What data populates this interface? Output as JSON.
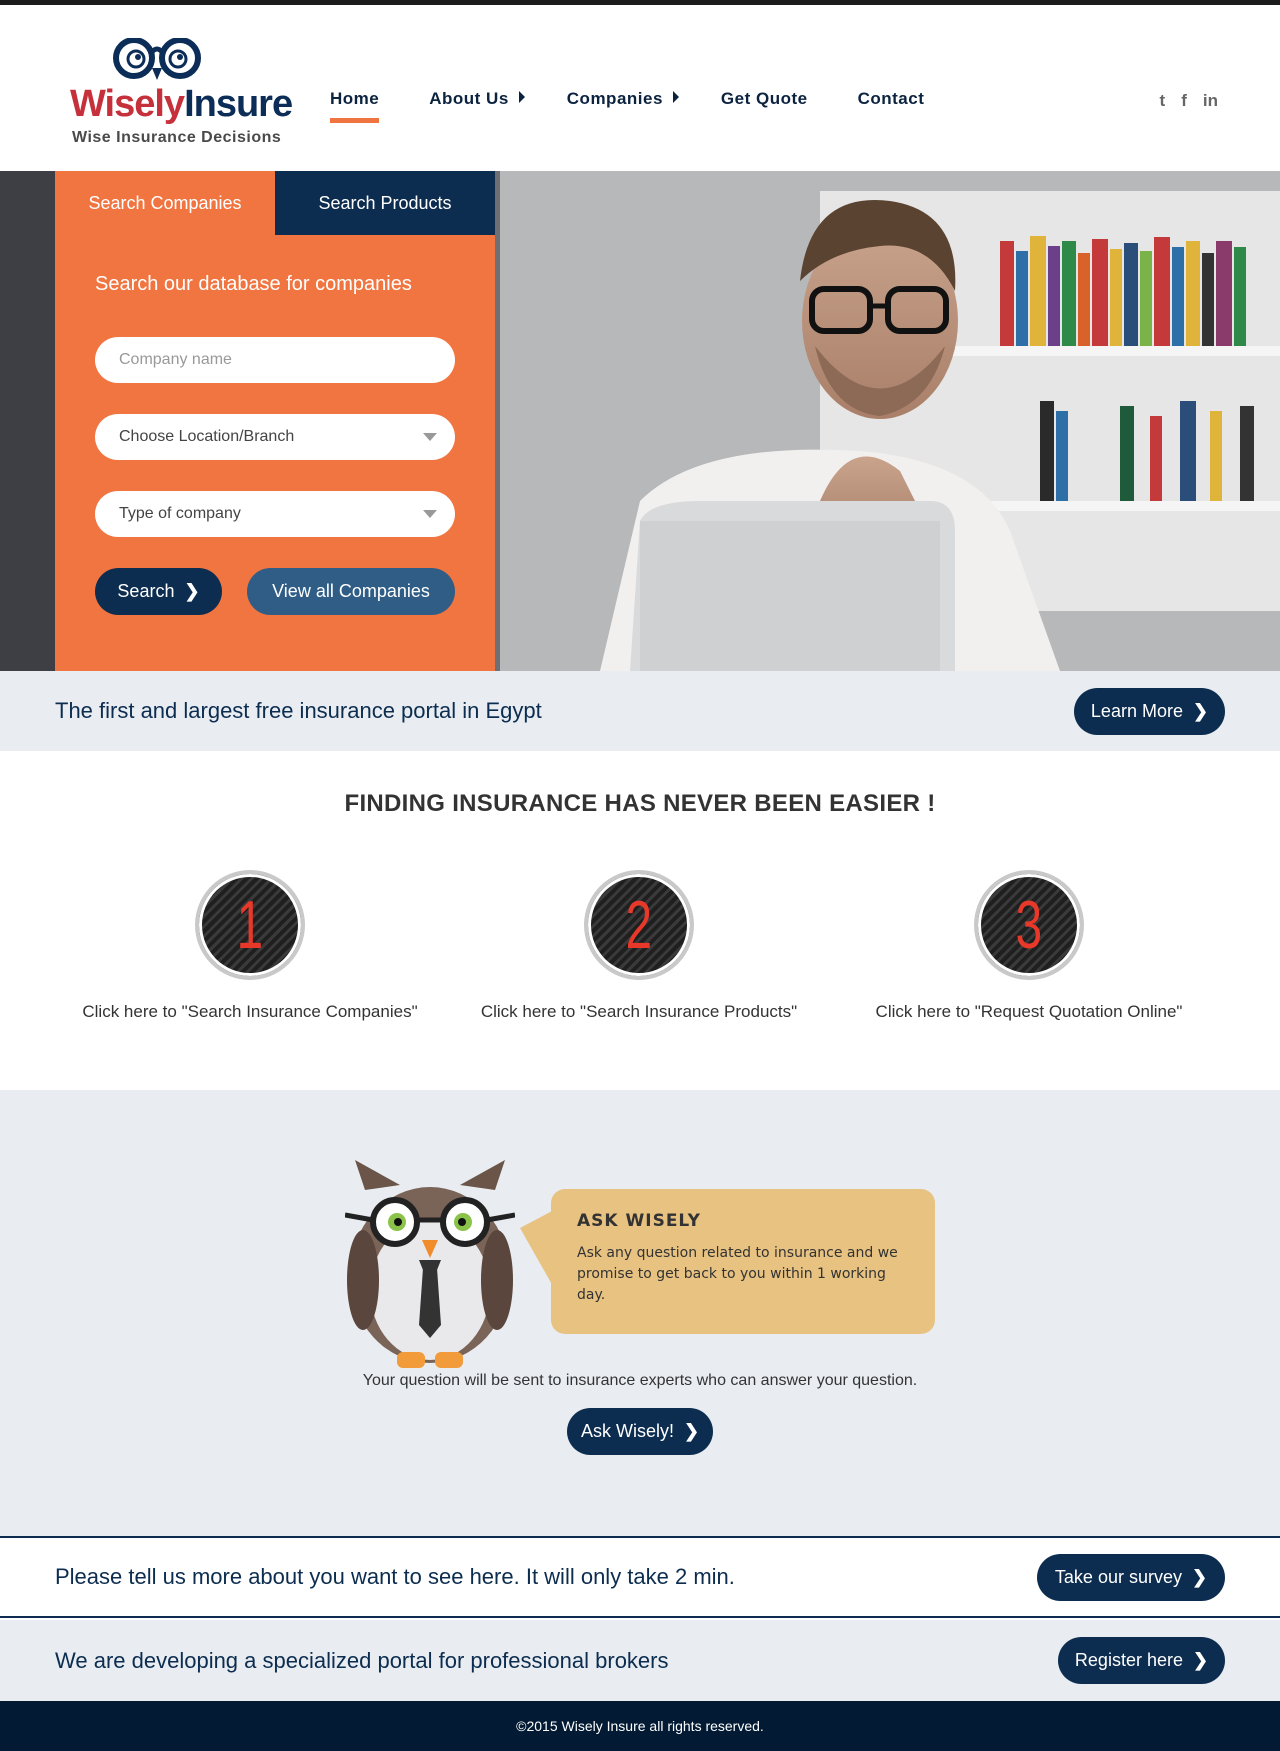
{
  "brand": {
    "name_part1": "Wisely",
    "name_part2": "Insure",
    "tagline": "Wise Insurance Decisions"
  },
  "nav": {
    "items": [
      {
        "label": "Home",
        "active": true,
        "has_caret": false
      },
      {
        "label": "About Us",
        "active": false,
        "has_caret": true
      },
      {
        "label": "Companies",
        "active": false,
        "has_caret": true
      },
      {
        "label": "Get Quote",
        "active": false,
        "has_caret": false
      },
      {
        "label": "Contact",
        "active": false,
        "has_caret": false
      }
    ]
  },
  "social": {
    "icons": [
      "twitter-icon",
      "facebook-icon",
      "linkedin-icon"
    ],
    "twitter": "t",
    "facebook": "f",
    "linkedin": "in"
  },
  "search_panel": {
    "tab_companies": "Search Companies",
    "tab_products": "Search Products",
    "heading": "Search our database for companies",
    "company_placeholder": "Company name",
    "location_value": "Choose Location/Branch",
    "type_value": "Type of company",
    "search_label": "Search",
    "view_all_label": "View all Companies"
  },
  "banner": {
    "text": "The first and largest free insurance portal in Egypt",
    "button": "Learn More"
  },
  "steps": {
    "title": "FINDING INSURANCE HAS NEVER BEEN EASIER !",
    "items": [
      {
        "number": "1",
        "label": "Click here to \"Search Insurance Companies\""
      },
      {
        "number": "2",
        "label": "Click here to \"Search Insurance Products\""
      },
      {
        "number": "3",
        "label": "Click here to \"Request Quotation Online\""
      }
    ]
  },
  "ask": {
    "bubble_title": "ASK WISELY",
    "bubble_text": "Ask any question related to insurance and we promise to get back to you within 1 working day.",
    "note": "Your question will be sent to insurance experts who can answer your question.",
    "button": "Ask Wisely!"
  },
  "survey": {
    "text": "Please tell us more about you want to see here. It will only take 2 min.",
    "button": "Take our survey"
  },
  "brokers": {
    "text": "We are developing a specialized portal for professional brokers",
    "button": "Register here"
  },
  "footer": {
    "copyright": "©2015 Wisely Insure all rights reserved."
  },
  "colors": {
    "accent_orange": "#f07541",
    "navy": "#0c2d4f",
    "light_bg": "#e9edf2",
    "step_number_red": "#e8382a"
  }
}
